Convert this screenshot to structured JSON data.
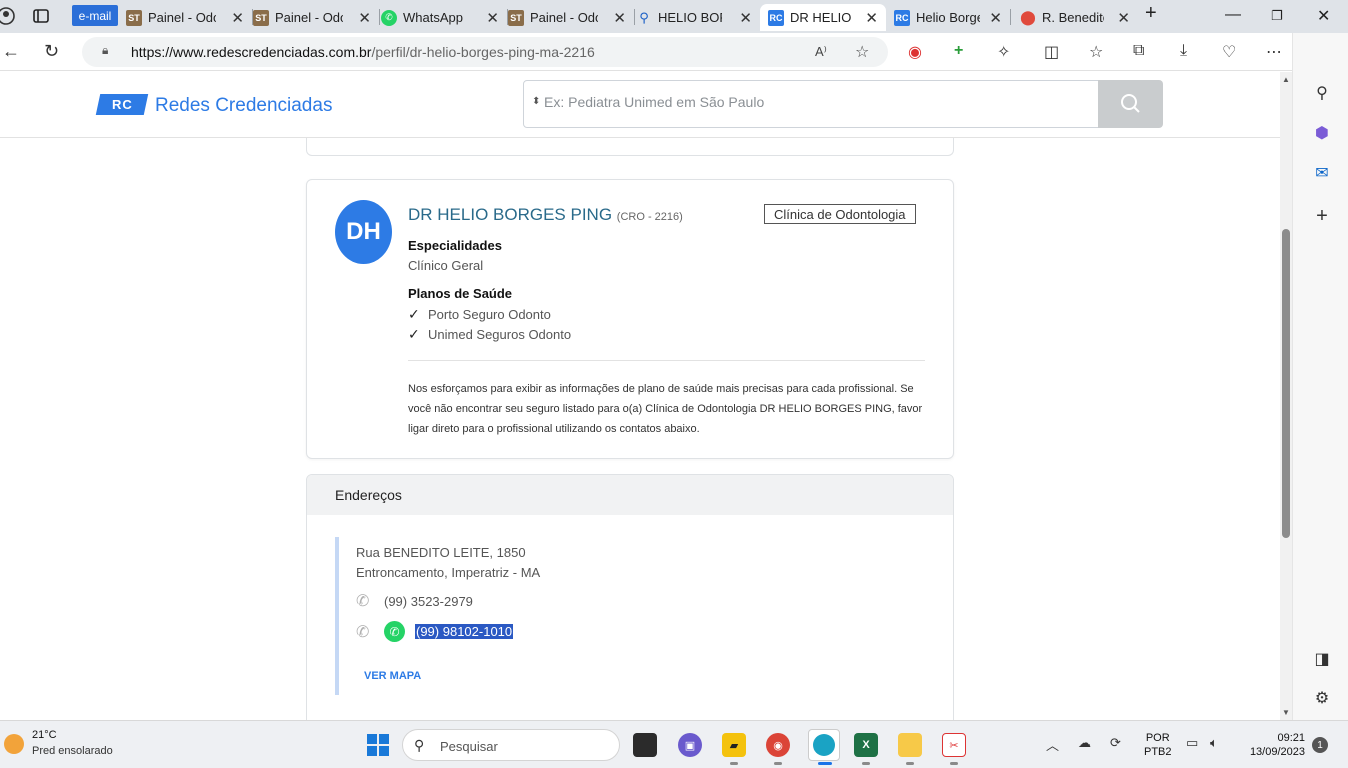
{
  "browser": {
    "email_chip": "e-mail",
    "tabs": [
      {
        "title": "Painel - Odo"
      },
      {
        "title": "Painel - Odo"
      },
      {
        "title": "WhatsApp"
      },
      {
        "title": "Painel - Odo"
      },
      {
        "title": "HELIO BORG"
      },
      {
        "title": "DR HELIO BO"
      },
      {
        "title": "Helio Borges"
      },
      {
        "title": "R. Benedito"
      }
    ],
    "active_tab_index": 5,
    "url_host": "https://www.redescredenciadas.com.br",
    "url_path": "/perfil/dr-helio-borges-ping-ma-2216",
    "window_controls": {
      "minimize": "—",
      "restore": "❐",
      "close": "✕"
    }
  },
  "site": {
    "logo_mark": "RC",
    "logo_text": "Redes Credenciadas",
    "search_placeholder": "Ex: Pediatra Unimed em São Paulo"
  },
  "profile": {
    "initials": "DH",
    "name": "DR HELIO BORGES PING",
    "cro": "(CRO - 2216)",
    "type_badge": "Clínica de Odontologia",
    "specialties_title": "Especialidades",
    "specialty": "Clínico Geral",
    "plans_title": "Planos de Saúde",
    "plans": [
      "Porto Seguro Odonto",
      "Unimed Seguros Odonto"
    ],
    "note": "Nos esforçamos para exibir as informações de plano de saúde mais precisas para cada profissional. Se você não encontrar seu seguro listado para o(a) Clínica de Odontologia DR HELIO BORGES PING, favor ligar direto para o profissional utilizando os contatos abaixo."
  },
  "addresses": {
    "title": "Endereços",
    "street": "Rua BENEDITO LEITE, 1850",
    "city": "Entroncamento, Imperatriz - MA",
    "phone1": "(99) 3523-2979",
    "phone2": "(99) 98102-1010",
    "map_link": "VER MAPA"
  },
  "taskbar": {
    "temperature": "21°C",
    "weather": "Pred ensolarado",
    "search_placeholder": "Pesquisar",
    "lang_line1": "POR",
    "lang_line2": "PTB2",
    "time": "09:21",
    "date": "13/09/2023",
    "notifications": "1"
  }
}
